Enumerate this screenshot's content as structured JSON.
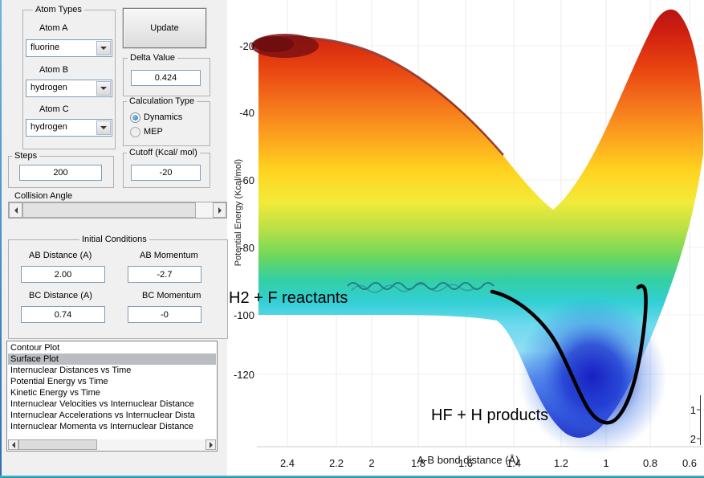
{
  "window": {
    "bg": "#f0f0f0",
    "accent_border": "#2f9ec4"
  },
  "controls": {
    "atom_types": {
      "title": "Atom Types",
      "fields": [
        {
          "label": "Atom A",
          "value": "fluorine"
        },
        {
          "label": "Atom B",
          "value": "hydrogen"
        },
        {
          "label": "Atom C",
          "value": "hydrogen"
        }
      ]
    },
    "update_button_label": "Update",
    "delta_value": {
      "title": "Delta Value",
      "value": "0.424"
    },
    "calculation_type": {
      "title": "Calculation Type",
      "options": [
        {
          "label": "Dynamics",
          "selected": true
        },
        {
          "label": "MEP",
          "selected": false
        }
      ]
    },
    "steps": {
      "title": "Steps",
      "value": "200"
    },
    "cutoff": {
      "title": "Cutoff (Kcal/ mol)",
      "value": "-20"
    },
    "collision_angle": {
      "label": "Collision Angle"
    },
    "initial_conditions": {
      "title": "Initial Conditions",
      "fields": [
        {
          "label": "AB Distance (A)",
          "value": "2.00"
        },
        {
          "label": "AB Momentum",
          "value": "-2.7"
        },
        {
          "label": "BC Distance (A)",
          "value": "0.74"
        },
        {
          "label": "BC Momentum",
          "value": "-0"
        }
      ]
    },
    "plot_list": {
      "items": [
        "Contour Plot",
        "Surface Plot",
        "Internuclear Distances vs Time",
        "Potential Energy vs Time",
        "Kinetic Energy vs Time",
        "Internuclear Velocities vs Internuclear Distance",
        "Internuclear Accelerations vs Internuclear Dista",
        "Internuclear Momenta vs Internuclear Distance"
      ],
      "selected": "Surface Plot",
      "selected_index": 1
    }
  },
  "chart_data": {
    "type": "surface",
    "title": "",
    "xlabel": "A-B bond distance (Å)",
    "ylabel": "Potential Energy (Kcal/mol)",
    "x_ticks": [
      "2.4",
      "2.2",
      "2",
      "1.8",
      "1.6",
      "1.4",
      "1.2",
      "1",
      "0.8",
      "0.6"
    ],
    "y_ticks": [
      "-20",
      "-40",
      "-60",
      "-80",
      "-100",
      "-120"
    ],
    "bc_ticks": [
      "1",
      "2"
    ],
    "ylim": [
      -130,
      -10
    ],
    "colormap": "jet",
    "grid": true,
    "annotations": [
      "H2 + F reactants",
      "HF + H products"
    ],
    "series": [
      {
        "name": "trajectory",
        "color": "#000000",
        "description": "dynamics trajectory from reactant valley into product well"
      }
    ]
  }
}
